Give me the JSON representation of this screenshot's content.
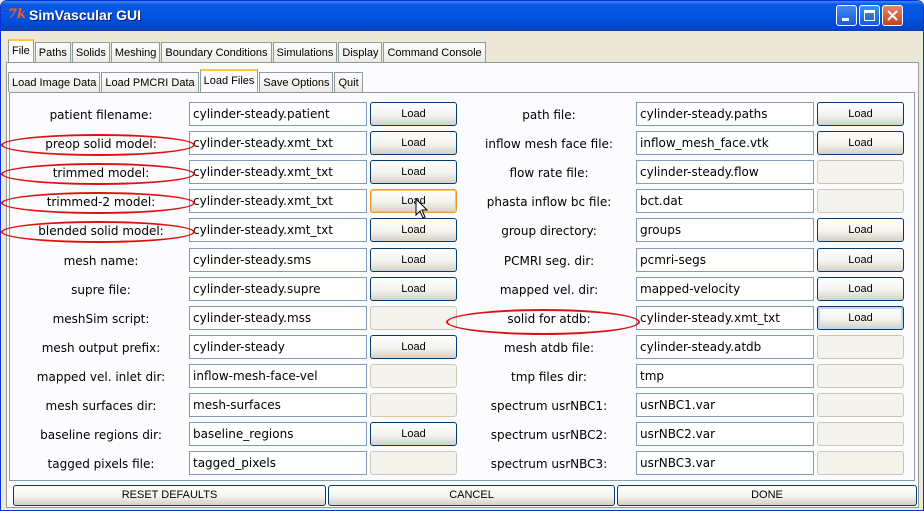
{
  "window": {
    "title": "SimVascular GUI",
    "icon": "tk-icon"
  },
  "main_tabs": [
    "File",
    "Paths",
    "Solids",
    "Meshing",
    "Boundary Conditions",
    "Simulations",
    "Display",
    "Command Console"
  ],
  "main_tab_active": "File",
  "sub_tabs": [
    "Load Image Data",
    "Load PMCRI Data",
    "Load Files",
    "Save Options",
    "Quit"
  ],
  "sub_tab_active": "Load Files",
  "load_label": "Load",
  "left_rows": [
    {
      "label": "patient filename:",
      "value": "cylinder-steady.patient",
      "button": "Load"
    },
    {
      "label": "preop solid model:",
      "value": "cylinder-steady.xmt_txt",
      "button": "Load"
    },
    {
      "label": "trimmed model:",
      "value": "cylinder-steady.xmt_txt",
      "button": "Load"
    },
    {
      "label": "trimmed-2 model:",
      "value": "cylinder-steady.xmt_txt",
      "button": "Load"
    },
    {
      "label": "blended solid model:",
      "value": "cylinder-steady.xmt_txt",
      "button": "Load"
    },
    {
      "label": "mesh name:",
      "value": "cylinder-steady.sms",
      "button": "Load"
    },
    {
      "label": "supre file:",
      "value": "cylinder-steady.supre",
      "button": "Load"
    },
    {
      "label": "meshSim script:",
      "value": "cylinder-steady.mss",
      "button": ""
    },
    {
      "label": "mesh output prefix:",
      "value": "cylinder-steady",
      "button": "Load"
    },
    {
      "label": "mapped vel. inlet dir:",
      "value": "inflow-mesh-face-vel",
      "button": ""
    },
    {
      "label": "mesh surfaces dir:",
      "value": "mesh-surfaces",
      "button": ""
    },
    {
      "label": "baseline regions dir:",
      "value": "baseline_regions",
      "button": "Load"
    },
    {
      "label": "tagged pixels file:",
      "value": "tagged_pixels",
      "button": ""
    }
  ],
  "right_rows": [
    {
      "label": "path file:",
      "value": "cylinder-steady.paths",
      "button": "Load"
    },
    {
      "label": "inflow mesh face file:",
      "value": "inflow_mesh_face.vtk",
      "button": "Load"
    },
    {
      "label": "flow rate file:",
      "value": "cylinder-steady.flow",
      "button": ""
    },
    {
      "label": "phasta inflow bc file:",
      "value": "bct.dat",
      "button": ""
    },
    {
      "label": "group directory:",
      "value": "groups",
      "button": "Load"
    },
    {
      "label": "PCMRI seg. dir:",
      "value": "pcmri-segs",
      "button": "Load"
    },
    {
      "label": "mapped vel. dir:",
      "value": "mapped-velocity",
      "button": "Load"
    },
    {
      "label": "solid for atdb:",
      "value": "cylinder-steady.xmt_txt",
      "button": "Load"
    },
    {
      "label": "mesh atdb file:",
      "value": "cylinder-steady.atdb",
      "button": ""
    },
    {
      "label": "tmp files dir:",
      "value": "tmp",
      "button": ""
    },
    {
      "label": "spectrum usrNBC1:",
      "value": "usrNBC1.var",
      "button": ""
    },
    {
      "label": "spectrum usrNBC2:",
      "value": "usrNBC2.var",
      "button": ""
    },
    {
      "label": "spectrum usrNBC3:",
      "value": "usrNBC3.var",
      "button": ""
    }
  ],
  "bottom_buttons": {
    "reset": "RESET DEFAULTS",
    "cancel": "CANCEL",
    "done": "DONE"
  },
  "annotation_color": "#e01010"
}
